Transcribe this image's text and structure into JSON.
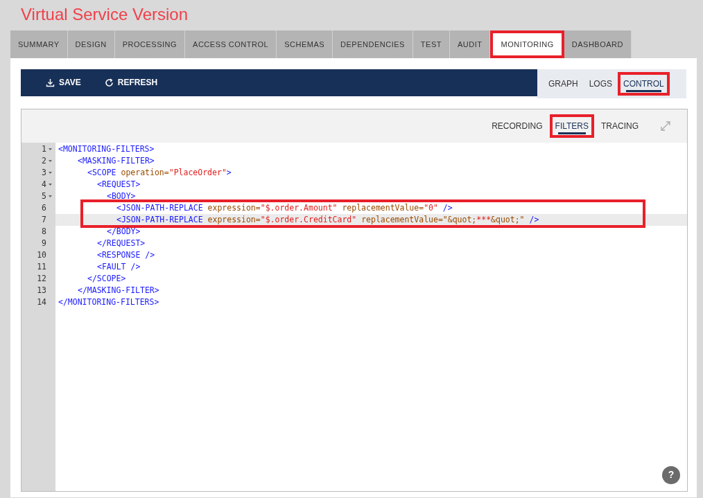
{
  "title": "Virtual Service Version",
  "tabs": [
    {
      "label": "SUMMARY",
      "selected": false,
      "annotated": false
    },
    {
      "label": "DESIGN",
      "selected": false,
      "annotated": false
    },
    {
      "label": "PROCESSING",
      "selected": false,
      "annotated": false
    },
    {
      "label": "ACCESS CONTROL",
      "selected": false,
      "annotated": false
    },
    {
      "label": "SCHEMAS",
      "selected": false,
      "annotated": false
    },
    {
      "label": "DEPENDENCIES",
      "selected": false,
      "annotated": false
    },
    {
      "label": "TEST",
      "selected": false,
      "annotated": false
    },
    {
      "label": "AUDIT",
      "selected": false,
      "annotated": false
    },
    {
      "label": "MONITORING",
      "selected": true,
      "annotated": true
    },
    {
      "label": "DASHBOARD",
      "selected": false,
      "annotated": false
    }
  ],
  "toolbar": [
    {
      "label": "SAVE",
      "kind": "save"
    },
    {
      "label": "REFRESH",
      "kind": "refresh"
    }
  ],
  "view_tabs": [
    {
      "label": "GRAPH",
      "selected": false,
      "annotated": false
    },
    {
      "label": "LOGS",
      "selected": false,
      "annotated": false
    },
    {
      "label": "CONTROL",
      "selected": true,
      "annotated": true
    }
  ],
  "editor_tabs": [
    {
      "label": "RECORDING",
      "selected": false,
      "annotated": false
    },
    {
      "label": "FILTERS",
      "selected": true,
      "annotated": true
    },
    {
      "label": "TRACING",
      "selected": false,
      "annotated": false
    }
  ],
  "lines": [
    {
      "number": "1",
      "foldable": true,
      "active": false,
      "annotated": false,
      "tokens": [
        {
          "kind": "tag",
          "text": "<MONITORING-FILTERS>"
        }
      ],
      "children": [
        {
          "number": "2",
          "foldable": true,
          "active": false,
          "annotated": false,
          "tokens": [
            {
              "kind": "tag",
              "text": "<MASKING-FILTER>"
            }
          ],
          "children": [
            {
              "number": "3",
              "foldable": true,
              "active": false,
              "annotated": false,
              "tokens": [
                {
                  "kind": "tag",
                  "text": "<SCOPE"
                },
                {
                  "kind": "attr",
                  "text": " operation="
                },
                {
                  "kind": "value",
                  "text": "\"PlaceOrder\""
                },
                {
                  "kind": "tag",
                  "text": ">"
                }
              ],
              "children": [
                {
                  "number": "4",
                  "foldable": true,
                  "active": false,
                  "annotated": false,
                  "tokens": [
                    {
                      "kind": "tag",
                      "text": "<REQUEST>"
                    }
                  ],
                  "children": [
                    {
                      "number": "5",
                      "foldable": true,
                      "active": false,
                      "annotated": false,
                      "tokens": [
                        {
                          "kind": "tag",
                          "text": "<BODY>"
                        }
                      ],
                      "children": [
                        {
                          "number": "6",
                          "foldable": false,
                          "active": false,
                          "annotated": true,
                          "tokens": [
                            {
                              "kind": "tag",
                              "text": "<JSON-PATH-REPLACE"
                            },
                            {
                              "kind": "attr",
                              "text": " expression="
                            },
                            {
                              "kind": "value",
                              "text": "\"$.order.Amount\""
                            },
                            {
                              "kind": "attr",
                              "text": " replacementValue="
                            },
                            {
                              "kind": "value",
                              "text": "\"0\""
                            },
                            {
                              "kind": "tag",
                              "text": " />"
                            }
                          ]
                        },
                        {
                          "number": "7",
                          "foldable": false,
                          "active": true,
                          "annotated": true,
                          "tokens": [
                            {
                              "kind": "tag",
                              "text": "<JSON-PATH-REPLACE"
                            },
                            {
                              "kind": "attr",
                              "text": " expression="
                            },
                            {
                              "kind": "value",
                              "text": "\"$.order.CreditCard\""
                            },
                            {
                              "kind": "attr",
                              "text": " replacementValue=\"&quot;"
                            },
                            {
                              "kind": "value",
                              "text": "***"
                            },
                            {
                              "kind": "attr",
                              "text": "&quot;\""
                            },
                            {
                              "kind": "tag",
                              "text": " />"
                            }
                          ]
                        }
                      ]
                    },
                    {
                      "number": "8",
                      "foldable": false,
                      "active": false,
                      "annotated": false,
                      "tokens": [
                        {
                          "kind": "tag",
                          "text": "</BODY>"
                        }
                      ]
                    }
                  ]
                },
                {
                  "number": "9",
                  "foldable": false,
                  "active": false,
                  "annotated": false,
                  "tokens": [
                    {
                      "kind": "tag",
                      "text": "</REQUEST>"
                    }
                  ]
                },
                {
                  "number": "10",
                  "foldable": false,
                  "active": false,
                  "annotated": false,
                  "tokens": [
                    {
                      "kind": "tag",
                      "text": "<RESPONSE />"
                    }
                  ]
                },
                {
                  "number": "11",
                  "foldable": false,
                  "active": false,
                  "annotated": false,
                  "tokens": [
                    {
                      "kind": "tag",
                      "text": "<FAULT />"
                    }
                  ]
                }
              ]
            },
            {
              "number": "12",
              "foldable": false,
              "active": false,
              "annotated": false,
              "tokens": [
                {
                  "kind": "tag",
                  "text": "</SCOPE>"
                }
              ]
            }
          ]
        },
        {
          "number": "13",
          "foldable": false,
          "active": false,
          "annotated": false,
          "tokens": [
            {
              "kind": "tag",
              "text": "</MASKING-FILTER>"
            }
          ]
        }
      ]
    },
    {
      "number": "14",
      "foldable": false,
      "active": false,
      "annotated": false,
      "tokens": [
        {
          "kind": "tag",
          "text": "</MONITORING-FILTERS>"
        }
      ]
    }
  ],
  "help": {
    "label": "?"
  }
}
